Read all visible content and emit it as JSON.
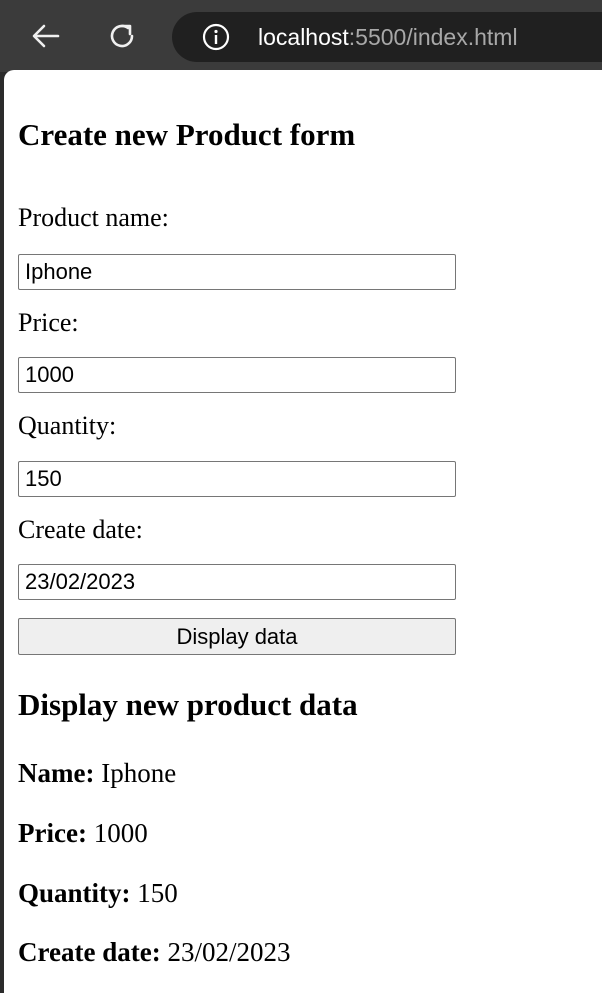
{
  "browser": {
    "url_host": "localhost",
    "url_rest": ":5500/index.html",
    "back_icon": "arrow-left-icon",
    "reload_icon": "reload-icon",
    "info_icon": "info-icon"
  },
  "form": {
    "title": "Create new Product form",
    "fields": [
      {
        "label": "Product name:",
        "value": "Iphone"
      },
      {
        "label": "Price:",
        "value": "1000"
      },
      {
        "label": "Quantity:",
        "value": "150"
      },
      {
        "label": "Create date:",
        "value": "23/02/2023"
      }
    ],
    "button_label": "Display data"
  },
  "display": {
    "title": "Display new product data",
    "rows": [
      {
        "key": "Name:",
        "value": "Iphone"
      },
      {
        "key": "Price:",
        "value": "1000"
      },
      {
        "key": "Quantity:",
        "value": "150"
      },
      {
        "key": "Create date:",
        "value": "23/02/2023"
      }
    ]
  }
}
